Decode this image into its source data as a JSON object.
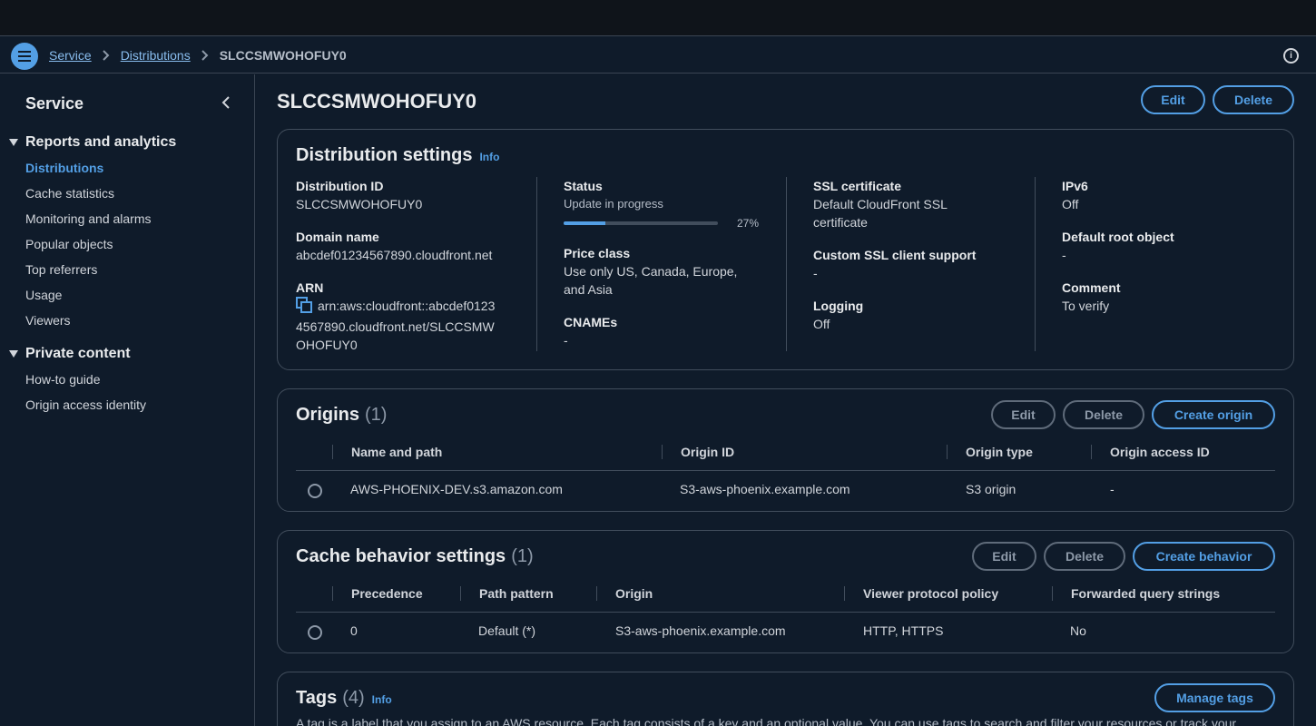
{
  "breadcrumb": {
    "service": "Service",
    "distributions": "Distributions",
    "current": "SLCCSMWOHOFUY0"
  },
  "sidebar": {
    "title": "Service",
    "sections": [
      {
        "label": "Reports and analytics",
        "items": [
          "Distributions",
          "Cache statistics",
          "Monitoring and alarms",
          "Popular objects",
          "Top referrers",
          "Usage",
          "Viewers"
        ]
      },
      {
        "label": "Private content",
        "items": [
          "How-to guide",
          "Origin access identity"
        ]
      }
    ],
    "active": "Distributions"
  },
  "page": {
    "title": "SLCCSMWOHOFUY0",
    "edit": "Edit",
    "delete": "Delete"
  },
  "settings": {
    "title": "Distribution settings",
    "info": "Info",
    "distribution_id_label": "Distribution ID",
    "distribution_id": "SLCCSMWOHOFUY0",
    "domain_label": "Domain name",
    "domain": "abcdef01234567890.cloudfront.net",
    "arn_label": "ARN",
    "arn_line1": "arn:aws:cloudfront::abcdef0123",
    "arn_line2": "4567890.cloudfront.net/SLCCSMW",
    "arn_line3": "OHOFUY0",
    "status_label": "Status",
    "status_text": "Update in progress",
    "status_progress": 27,
    "status_pct": "27%",
    "price_label": "Price class",
    "price_line1": "Use only US, Canada, Europe,",
    "price_line2": "and Asia",
    "cnames_label": "CNAMEs",
    "cnames": "-",
    "ssl_label": "SSL certificate",
    "ssl_line1": "Default CloudFront SSL",
    "ssl_line2": "certificate",
    "custom_ssl_label": "Custom SSL client support",
    "custom_ssl": "-",
    "logging_label": "Logging",
    "logging": "Off",
    "ipv6_label": "IPv6",
    "ipv6": "Off",
    "root_label": "Default root object",
    "root": "-",
    "comment_label": "Comment",
    "comment": "To verify"
  },
  "origins": {
    "title": "Origins",
    "count": "(1)",
    "edit": "Edit",
    "delete": "Delete",
    "create": "Create origin",
    "columns": [
      "Name and path",
      "Origin ID",
      "Origin type",
      "Origin access ID"
    ],
    "rows": [
      [
        "AWS-PHOENIX-DEV.s3.amazon.com",
        "S3-aws-phoenix.example.com",
        "S3 origin",
        "-"
      ]
    ]
  },
  "behaviors": {
    "title": "Cache behavior settings",
    "count": "(1)",
    "edit": "Edit",
    "delete": "Delete",
    "create": "Create behavior",
    "columns": [
      "Precedence",
      "Path pattern",
      "Origin",
      "Viewer protocol policy",
      "Forwarded query strings"
    ],
    "rows": [
      [
        "0",
        "Default (*)",
        "S3-aws-phoenix.example.com",
        "HTTP, HTTPS",
        "No"
      ]
    ]
  },
  "tags": {
    "title": "Tags",
    "count": "(4)",
    "info": "Info",
    "manage": "Manage tags",
    "description": "A tag is a label that you assign to an AWS resource. Each tag consists of a key and an optional value. You can use tags to search and filter your resources or track your"
  },
  "colors": {
    "accent": "#539fe5",
    "background": "#0f1b2a",
    "topbar": "#0f141a",
    "border": "#414d5c"
  }
}
